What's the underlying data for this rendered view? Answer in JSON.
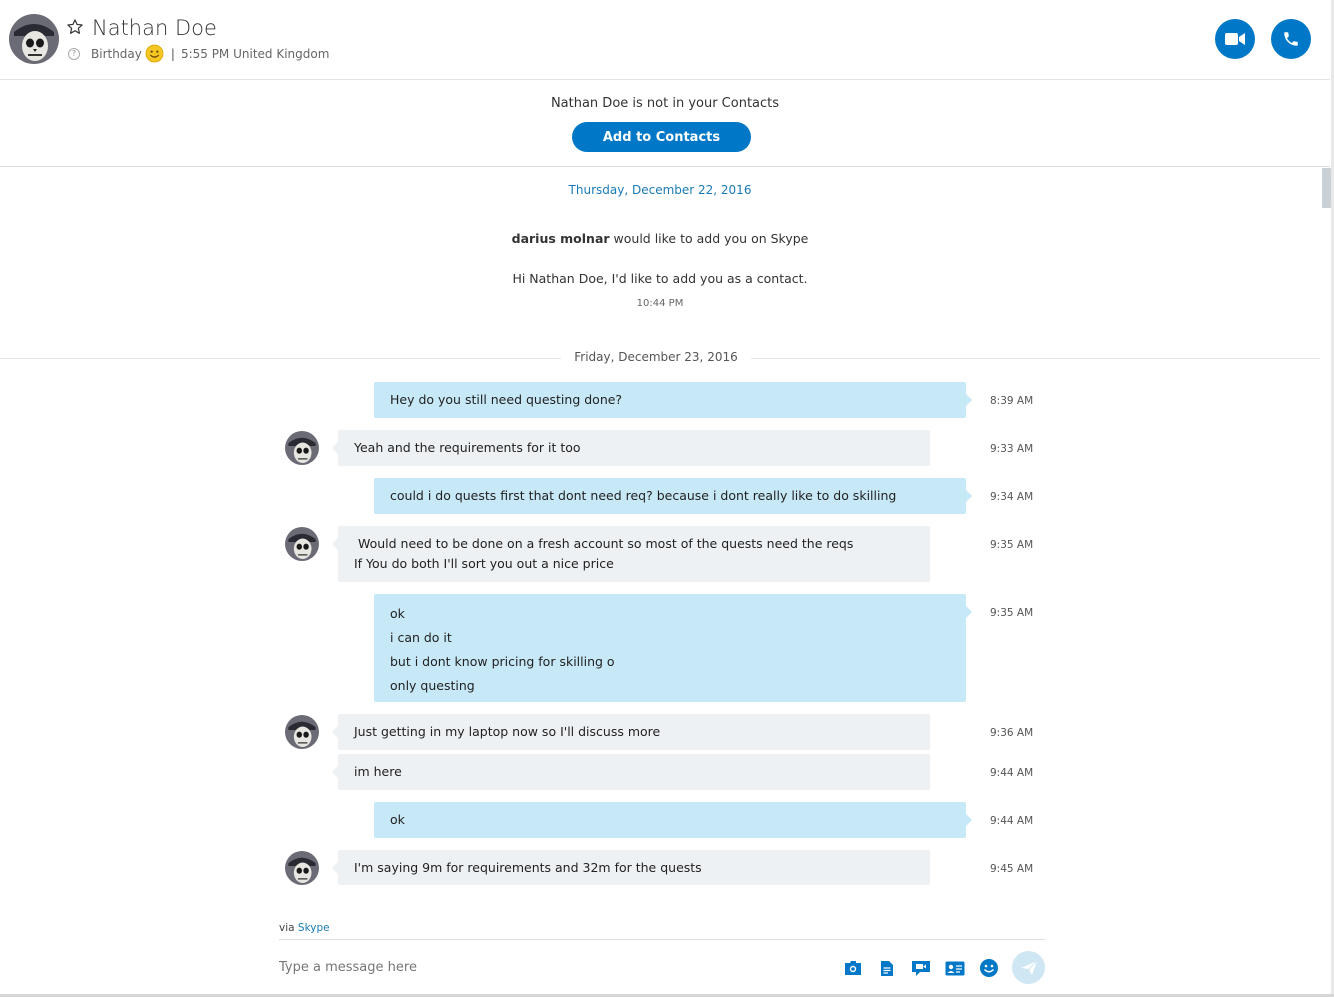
{
  "header": {
    "name": "Nathan Doe",
    "mood": "Birthday",
    "time_location": "5:55 PM United Kingdom"
  },
  "banner": {
    "text": "Nathan Doe is not in your Contacts",
    "button": "Add to Contacts"
  },
  "day1": "Thursday, December 22, 2016",
  "request": {
    "sender": "darius molnar",
    "line_suffix": " would like to add you on Skype",
    "message": "Hi Nathan Doe, I'd like to add you as a contact.",
    "time": "10:44 PM"
  },
  "day2": "Friday, December 23, 2016",
  "messages": [
    {
      "dir": "out",
      "lines": [
        "Hey do you still need questing done?"
      ],
      "time": "8:39 AM"
    },
    {
      "dir": "in",
      "lines": [
        "Yeah and the requirements for it too"
      ],
      "time": "9:33 AM"
    },
    {
      "dir": "out",
      "lines": [
        "could i do quests first that dont need req? because i dont really like to do skilling"
      ],
      "time": "9:34 AM"
    },
    {
      "dir": "in",
      "lines": [
        " Would need to be done on a fresh account so most of the quests need the reqs",
        "If You do both I'll sort you out a nice price"
      ],
      "time": "9:35 AM"
    },
    {
      "dir": "out",
      "lines": [
        "ok",
        "i can do it",
        "but i dont know pricing for skilling o",
        "only questing"
      ],
      "time": "9:35 AM"
    },
    {
      "dir": "in",
      "lines": [
        "Just getting in my laptop now so I'll discuss more"
      ],
      "time": "9:36 AM"
    },
    {
      "dir": "in",
      "lines": [
        "im here"
      ],
      "time": "9:44 AM"
    },
    {
      "dir": "out",
      "lines": [
        "ok"
      ],
      "time": "9:44 AM"
    },
    {
      "dir": "in",
      "lines": [
        "I'm saying 9m for requirements and 32m for the quests"
      ],
      "time": "9:45 AM"
    }
  ],
  "footer": {
    "via_prefix": "via ",
    "via_link": "Skype",
    "placeholder": "Type a message here"
  },
  "colors": {
    "accent": "#0078c7",
    "outgoing_bubble": "#c7e8f7",
    "incoming_bubble": "#eef1f4"
  }
}
